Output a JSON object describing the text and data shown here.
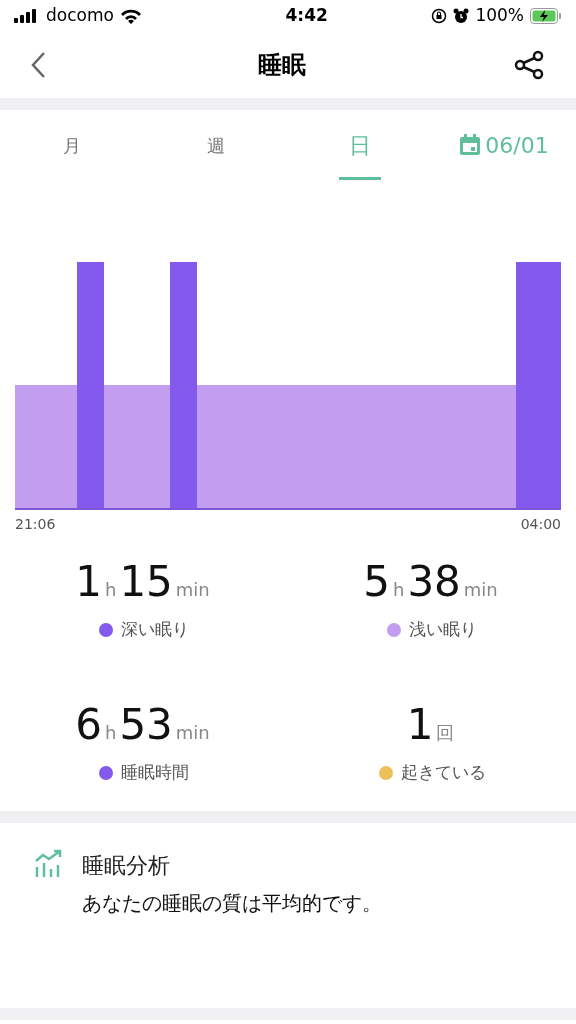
{
  "status_bar": {
    "carrier": "docomo",
    "time": "4:42",
    "battery": "100%"
  },
  "nav": {
    "title": "睡眠"
  },
  "tabs": [
    {
      "label": "月",
      "selected": false,
      "kind": "text"
    },
    {
      "label": "週",
      "selected": false,
      "kind": "text"
    },
    {
      "label": "日",
      "selected": true,
      "kind": "text"
    },
    {
      "label": "06/01",
      "selected": false,
      "kind": "date"
    }
  ],
  "timeline": {
    "start": "21:06",
    "end": "04:00"
  },
  "stats": [
    {
      "parts": [
        {
          "text": "1",
          "kind": "number"
        },
        {
          "text": "h",
          "kind": "unit"
        },
        {
          "text": "15",
          "kind": "number"
        },
        {
          "text": "min",
          "kind": "unit"
        }
      ],
      "label": "深い眠り",
      "color": "#8459ee"
    },
    {
      "parts": [
        {
          "text": "5",
          "kind": "number"
        },
        {
          "text": "h",
          "kind": "unit"
        },
        {
          "text": "38",
          "kind": "number"
        },
        {
          "text": "min",
          "kind": "unit"
        }
      ],
      "label": "浅い眠り",
      "color": "#c39ef0"
    },
    {
      "parts": [
        {
          "text": "6",
          "kind": "number"
        },
        {
          "text": "h",
          "kind": "unit"
        },
        {
          "text": "53",
          "kind": "number"
        },
        {
          "text": "min",
          "kind": "unit"
        }
      ],
      "label": "睡眠時間",
      "color": "#8459ee"
    },
    {
      "parts": [
        {
          "text": "1",
          "kind": "number"
        },
        {
          "text": "回",
          "kind": "unit"
        }
      ],
      "label": "起きている",
      "color": "#ecc15a"
    }
  ],
  "analysis": {
    "title": "睡眠分析",
    "text": "あなたの睡眠の質は平均的です。"
  }
}
